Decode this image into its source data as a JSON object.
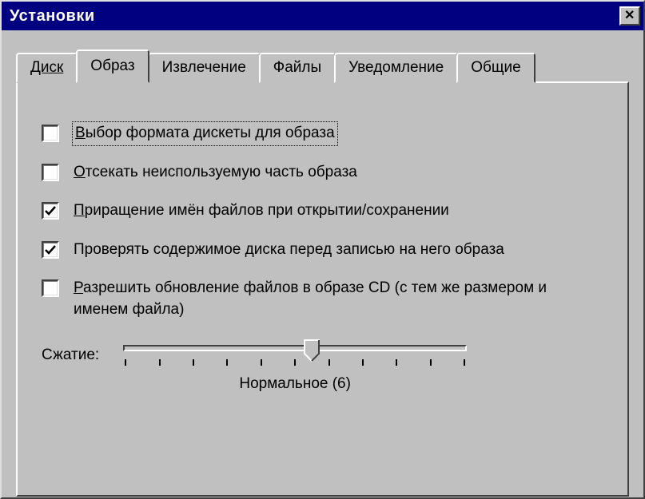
{
  "window": {
    "title": "Установки"
  },
  "tabs": {
    "items": [
      {
        "label": "Диск"
      },
      {
        "label": "Образ"
      },
      {
        "label": "Извлечение"
      },
      {
        "label": "Файлы"
      },
      {
        "label": "Уведомление"
      },
      {
        "label": "Общие"
      }
    ],
    "active_index": 1
  },
  "options": [
    {
      "checked": false,
      "mnemonic": "В",
      "rest": "ыбор формата дискеты для образа",
      "focused": true
    },
    {
      "checked": false,
      "mnemonic": "О",
      "rest": "тсекать неиспользуемую часть образа",
      "focused": false
    },
    {
      "checked": true,
      "mnemonic": "П",
      "rest": "риращение имён файлов при открытии/сохранении",
      "focused": false
    },
    {
      "checked": true,
      "mnemonic": "",
      "rest": "Проверять содержимое диска перед записью на него образа",
      "focused": false
    },
    {
      "checked": false,
      "mnemonic": "Р",
      "rest": "азрешить обновление файлов в образе CD (с тем же размером и именем файла)",
      "focused": false
    }
  ],
  "slider": {
    "label_mnemonic": "С",
    "label_rest": "жатие:",
    "value_text": "Нормальное (6)",
    "ticks": 11,
    "position_percent": 55
  }
}
